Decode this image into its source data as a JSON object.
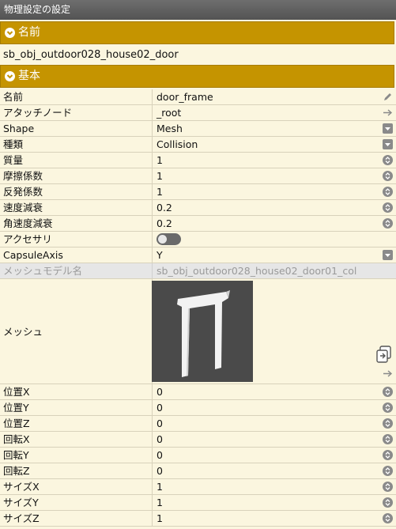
{
  "window": {
    "title": "物理設定の設定"
  },
  "section_name": {
    "label": "名前",
    "value": "sb_obj_outdoor028_house02_door"
  },
  "section_basic": {
    "label": "基本"
  },
  "props": [
    {
      "label": "名前",
      "value": "door_frame",
      "control": "pencil-icon"
    },
    {
      "label": "アタッチノード",
      "value": "_root",
      "control": "arrow-right-icon"
    },
    {
      "label": "Shape",
      "value": "Mesh",
      "control": "dropdown-icon"
    },
    {
      "label": "種類",
      "value": "Collision",
      "control": "dropdown-icon"
    },
    {
      "label": "質量",
      "value": "1",
      "control": "spinner-icon"
    },
    {
      "label": "摩擦係数",
      "value": "1",
      "control": "spinner-icon"
    },
    {
      "label": "反発係数",
      "value": "1",
      "control": "spinner-icon"
    },
    {
      "label": "速度減衰",
      "value": "0.2",
      "control": "spinner-icon"
    },
    {
      "label": "角速度減衰",
      "value": "0.2",
      "control": "spinner-icon"
    },
    {
      "label": "アクセサリ",
      "value": "",
      "control": "toggle",
      "toggle_on": false
    },
    {
      "label": "CapsuleAxis",
      "value": "Y",
      "control": "dropdown-icon"
    },
    {
      "label": "メッシュモデル名",
      "value": "sb_obj_outdoor028_house02_door01_col",
      "disabled": true
    },
    {
      "label": "メッシュ",
      "value": "",
      "control": "mesh-thumbnail"
    },
    {
      "label": "位置X",
      "value": "0",
      "control": "spinner-icon"
    },
    {
      "label": "位置Y",
      "value": "0",
      "control": "spinner-icon"
    },
    {
      "label": "位置Z",
      "value": "0",
      "control": "spinner-icon"
    },
    {
      "label": "回転X",
      "value": "0",
      "control": "spinner-icon"
    },
    {
      "label": "回転Y",
      "value": "0",
      "control": "spinner-icon"
    },
    {
      "label": "回転Z",
      "value": "0",
      "control": "spinner-icon"
    },
    {
      "label": "サイズX",
      "value": "1",
      "control": "spinner-icon"
    },
    {
      "label": "サイズY",
      "value": "1",
      "control": "spinner-icon"
    },
    {
      "label": "サイズZ",
      "value": "1",
      "control": "spinner-icon"
    }
  ],
  "colors": {
    "section_bar": "#c59400",
    "panel_bg": "#fbf6df",
    "titlebar": "#5f5f5f"
  }
}
